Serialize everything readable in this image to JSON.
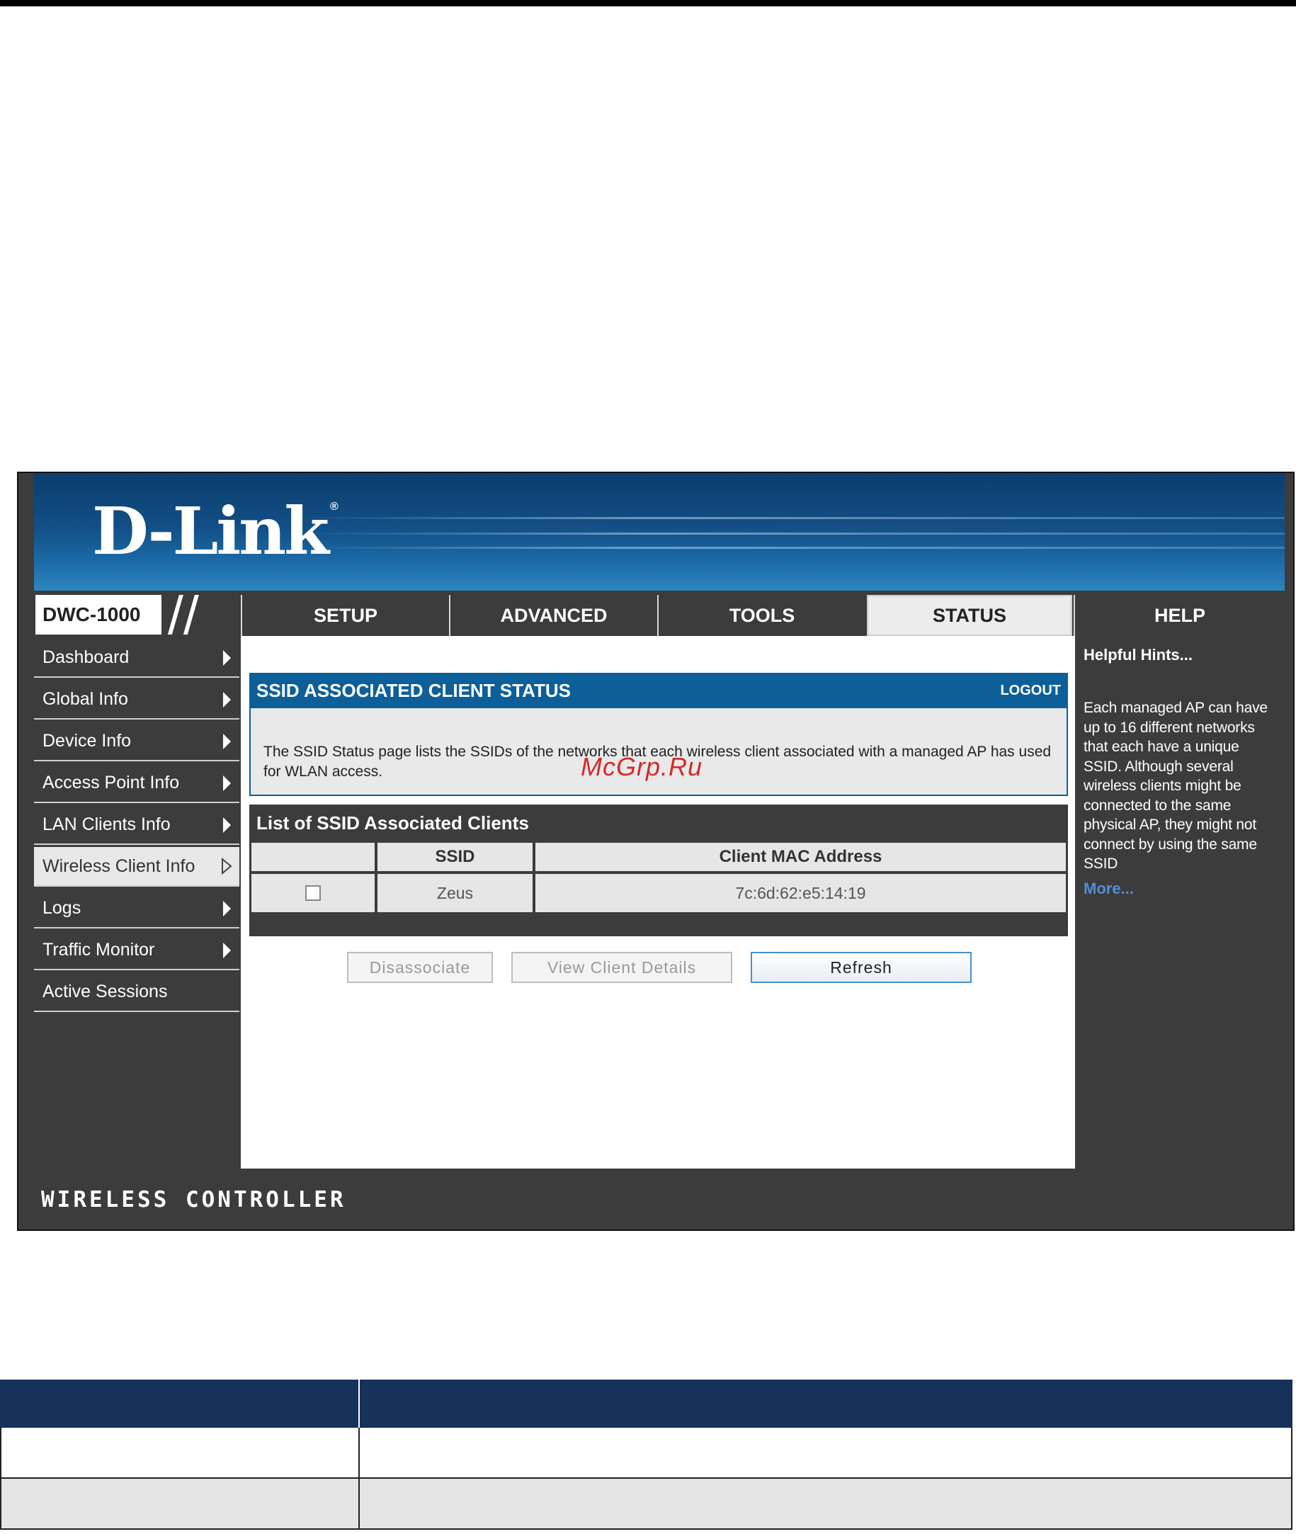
{
  "app": {
    "brand": "D-Link",
    "model": "DWC-1000",
    "footer": "WIRELESS CONTROLLER"
  },
  "nav": {
    "tabs": [
      {
        "label": "SETUP",
        "active": false
      },
      {
        "label": "ADVANCED",
        "active": false
      },
      {
        "label": "TOOLS",
        "active": false
      },
      {
        "label": "STATUS",
        "active": true
      },
      {
        "label": "HELP",
        "active": false
      }
    ]
  },
  "sidebar": {
    "items": [
      {
        "label": "Dashboard",
        "arrow": true,
        "active": false
      },
      {
        "label": "Global Info",
        "arrow": true,
        "active": false
      },
      {
        "label": "Device Info",
        "arrow": true,
        "active": false
      },
      {
        "label": "Access Point Info",
        "arrow": true,
        "active": false
      },
      {
        "label": "LAN Clients Info",
        "arrow": true,
        "active": false
      },
      {
        "label": "Wireless Client Info",
        "arrow": true,
        "active": true
      },
      {
        "label": "Logs",
        "arrow": true,
        "active": false
      },
      {
        "label": "Traffic Monitor",
        "arrow": true,
        "active": false
      },
      {
        "label": "Active Sessions",
        "arrow": false,
        "active": false
      }
    ]
  },
  "panel": {
    "title": "SSID ASSOCIATED CLIENT STATUS",
    "logout": "LOGOUT",
    "description": "The SSID Status page lists the SSIDs of the networks that each wireless client associated with a managed AP has used for WLAN access."
  },
  "list": {
    "title": "List of SSID Associated Clients",
    "columns": [
      "",
      "SSID",
      "Client MAC Address"
    ],
    "rows": [
      {
        "checked": false,
        "ssid": "Zeus",
        "mac": "7c:6d:62:e5:14:19"
      }
    ]
  },
  "buttons": {
    "disassociate": "Disassociate",
    "view_details": "View Client Details",
    "refresh": "Refresh"
  },
  "help": {
    "title": "Helpful Hints...",
    "body": "Each managed AP can have up to 16 different networks that each have a unique SSID. Although several wireless clients might be connected to the same physical AP, they might not connect by using the same SSID",
    "more": "More..."
  },
  "watermark": "McGrp.Ru",
  "colors": {
    "banner": "#124e85",
    "panel_header": "#0d5f99",
    "chrome": "#3c3c3c",
    "table_header": "#17325a",
    "watermark": "#d42a2a"
  }
}
